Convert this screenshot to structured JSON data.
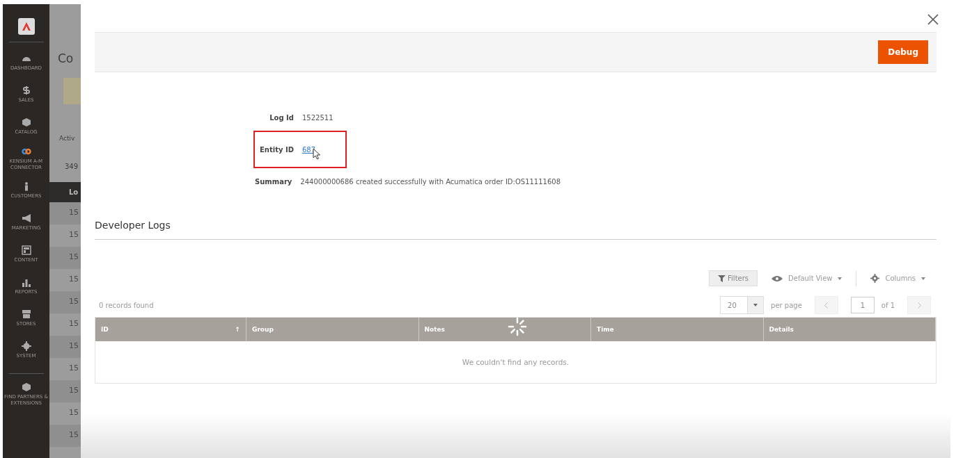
{
  "sidebar": {
    "items": [
      {
        "label": "DASHBOARD",
        "kind": "gauge"
      },
      {
        "label": "SALES",
        "kind": "dollar"
      },
      {
        "label": "CATALOG",
        "kind": "box"
      },
      {
        "label": "KENSIUM A-M CONNECTOR",
        "kind": "link"
      },
      {
        "label": "CUSTOMERS",
        "kind": "person"
      },
      {
        "label": "MARKETING",
        "kind": "megaphone"
      },
      {
        "label": "CONTENT",
        "kind": "layout"
      },
      {
        "label": "REPORTS",
        "kind": "bars"
      },
      {
        "label": "STORES",
        "kind": "store"
      },
      {
        "label": "SYSTEM",
        "kind": "gear"
      },
      {
        "label": "FIND PARTNERS & EXTENSIONS",
        "kind": "cube"
      }
    ]
  },
  "background_page": {
    "title": "Co",
    "tab": "Activ",
    "count": "349",
    "column": "Lo",
    "rows": [
      "15",
      "15",
      "15",
      "15",
      "15",
      "15",
      "15",
      "15",
      "15",
      "15",
      "15"
    ]
  },
  "modal": {
    "debug_button": "Debug",
    "fields": [
      {
        "label": "Log Id",
        "value": "1522511",
        "kind": "text",
        "highlighted": false
      },
      {
        "label": "Entity ID",
        "value": "687",
        "kind": "link",
        "highlighted": true
      },
      {
        "label": "Summary",
        "value": "244000000686 created successfully with Acumatica order ID:OS11111608",
        "kind": "text",
        "highlighted": false
      }
    ],
    "section_title": "Developer Logs",
    "toolbar": {
      "filters": "Filters",
      "view": "Default View",
      "columns": "Columns"
    },
    "records_found": "0 records found",
    "pager": {
      "page_size": "20",
      "per_page": "per page",
      "page": "1",
      "of": "of 1"
    },
    "table": {
      "columns": [
        {
          "label": "ID",
          "sorted": true
        },
        {
          "label": "Group",
          "sorted": false
        },
        {
          "label": "Notes",
          "sorted": false
        },
        {
          "label": "Time",
          "sorted": false
        },
        {
          "label": "Details",
          "sorted": false
        }
      ],
      "sort_mark": "↑",
      "empty_message": "We couldn't find any records."
    }
  }
}
